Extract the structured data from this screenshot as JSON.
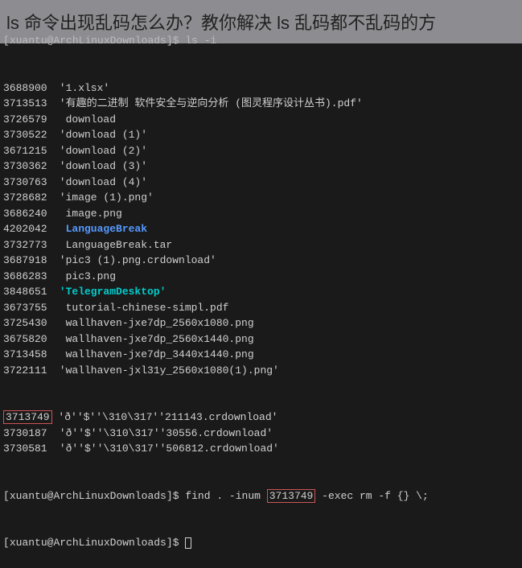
{
  "overlay": {
    "title": "ls 命令出现乱码怎么办？教你解决 ls 乱码都不乱码的方"
  },
  "terminal": {
    "prompt": {
      "user": "xuantu",
      "host": "ArchLinuxDownloads",
      "symbol": "$"
    },
    "cmd1": "ls -i",
    "lines": [
      {
        "size": "3688900",
        "name": " '1.xlsx'",
        "cls": ""
      },
      {
        "size": "3713513",
        "name": " '有趣的二进制 软件安全与逆向分析 (图灵程序设计丛书).pdf'",
        "cls": ""
      },
      {
        "size": "3726579",
        "name": "  download",
        "cls": ""
      },
      {
        "size": "3730522",
        "name": " 'download (1)'",
        "cls": ""
      },
      {
        "size": "3671215",
        "name": " 'download (2)'",
        "cls": ""
      },
      {
        "size": "3730362",
        "name": " 'download (3)'",
        "cls": ""
      },
      {
        "size": "3730763",
        "name": " 'download (4)'",
        "cls": ""
      },
      {
        "size": "3728682",
        "name": " 'image (1).png'",
        "cls": ""
      },
      {
        "size": "3686240",
        "name": "  image.png",
        "cls": ""
      },
      {
        "size": "4202042",
        "name": "  LanguageBreak",
        "cls": "dir-blue"
      },
      {
        "size": "3732773",
        "name": "  LanguageBreak.tar",
        "cls": ""
      },
      {
        "size": "3687918",
        "name": " 'pic3 (1).png.crdownload'",
        "cls": ""
      },
      {
        "size": "3686283",
        "name": "  pic3.png",
        "cls": ""
      },
      {
        "size": "3848651",
        "name": " 'TelegramDesktop'",
        "cls": "dir-cyan"
      },
      {
        "size": "3673755",
        "name": "  tutorial-chinese-simpl.pdf",
        "cls": ""
      },
      {
        "size": "3725430",
        "name": "  wallhaven-jxe7dp_2560x1080.png",
        "cls": ""
      },
      {
        "size": "3675820",
        "name": "  wallhaven-jxe7dp_2560x1440.png",
        "cls": ""
      },
      {
        "size": "3713458",
        "name": "  wallhaven-jxe7dp_3440x1440.png",
        "cls": ""
      },
      {
        "size": "3722111",
        "name": " 'wallhaven-jxl31y_2560x1080(1).png'",
        "cls": ""
      }
    ],
    "garbled": [
      {
        "size": "3713749",
        "name": " 'ð''$''\\310\\317''211143.crdownload'",
        "hl": true
      },
      {
        "size": "3730187",
        "name": " 'ð''$''\\310\\317''30556.crdownload'",
        "hl": false
      },
      {
        "size": "3730581",
        "name": " 'ð''$''\\310\\317''506812.crdownload'",
        "hl": false
      }
    ],
    "cmd2_pre": "find . -inum ",
    "cmd2_inum": "3713749",
    "cmd2_post": " -exec rm -f {} \\;"
  }
}
